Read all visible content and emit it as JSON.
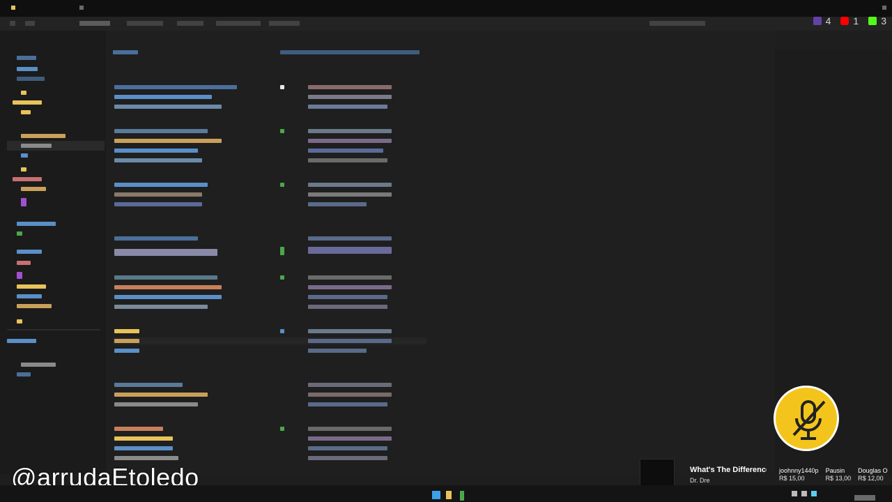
{
  "counters": [
    {
      "icon": "twitch-icon",
      "color": "#6441a5",
      "value": "4"
    },
    {
      "icon": "youtube-icon",
      "color": "#ff0000",
      "value": "1"
    },
    {
      "icon": "kick-icon",
      "color": "#53fc18",
      "value": "3"
    }
  ],
  "watermark": "@arrudaEtoledo",
  "mic_status": "muted",
  "now_playing": {
    "title": "What's The Difference",
    "artist": "Dr. Dre"
  },
  "donors": [
    {
      "name": "joohnny1440p",
      "amount": "R$ 15,00"
    },
    {
      "name": "Pausin",
      "amount": "R$ 13,00"
    },
    {
      "name": "Douglas O",
      "amount": "R$ 12,00"
    }
  ],
  "colors": {
    "accent": "#f3c51c",
    "background": "#1e1e1e",
    "yellow_token": "#e8c35a",
    "blue_token": "#5a8fc8",
    "green_token": "#4aa84a"
  }
}
